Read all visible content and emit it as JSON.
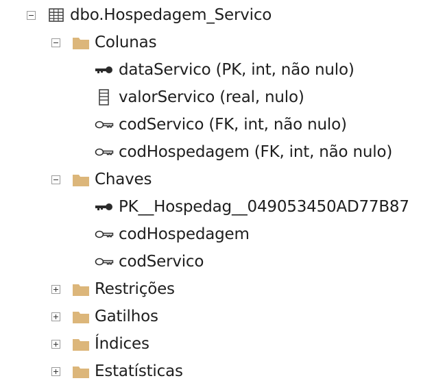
{
  "tree": {
    "table": {
      "label": "dbo.Hospedagem_Servico",
      "icon": "table-icon",
      "expanded": true
    },
    "columns_folder": {
      "label": "Colunas",
      "icon": "folder-icon",
      "expanded": true
    },
    "columns": [
      {
        "label": "dataServico (PK, int, não nulo)",
        "icon": "primary-key-icon"
      },
      {
        "label": "valorServico (real, nulo)",
        "icon": "column-icon"
      },
      {
        "label": "codServico (FK, int, não nulo)",
        "icon": "foreign-key-icon"
      },
      {
        "label": "codHospedagem (FK, int, não nulo)",
        "icon": "foreign-key-icon"
      }
    ],
    "keys_folder": {
      "label": "Chaves",
      "icon": "folder-icon",
      "expanded": true
    },
    "keys": [
      {
        "label": "PK__Hospedag__049053450AD77B87",
        "icon": "primary-key-icon"
      },
      {
        "label": "codHospedagem",
        "icon": "foreign-key-icon"
      },
      {
        "label": "codServico",
        "icon": "foreign-key-icon"
      }
    ],
    "collapsed_folders": [
      {
        "label": "Restrições",
        "icon": "folder-icon",
        "expanded": false
      },
      {
        "label": "Gatilhos",
        "icon": "folder-icon",
        "expanded": false
      },
      {
        "label": "Índices",
        "icon": "folder-icon",
        "expanded": false
      },
      {
        "label": "Estatísticas",
        "icon": "folder-icon",
        "expanded": false
      }
    ]
  },
  "colors": {
    "folder": "#dcb67a",
    "icon_dark": "#424242",
    "background": "#ffffff"
  }
}
